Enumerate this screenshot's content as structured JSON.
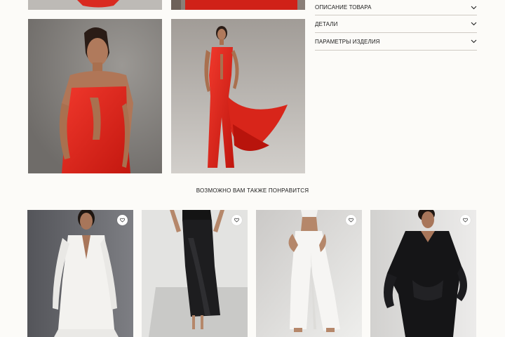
{
  "product_details": {
    "sections": [
      {
        "label": "ОПИСАНИЕ ТОВАРА",
        "icon": "chevron-down-icon"
      },
      {
        "label": "ДЕТАЛИ",
        "icon": "chevron-down-icon"
      },
      {
        "label": "ПАРАМЕТРЫ ИЗДЕЛИЯ",
        "icon": "chevron-down-icon"
      }
    ]
  },
  "recommendations": {
    "title": "ВОЗМОЖНО ВАМ ТАКЖЕ ПОНРАВИТСЯ",
    "favorite_icon": "heart-icon"
  },
  "colors": {
    "product_red": "#e4271f",
    "background": "#fcfbf8",
    "divider": "#cfcac3"
  }
}
